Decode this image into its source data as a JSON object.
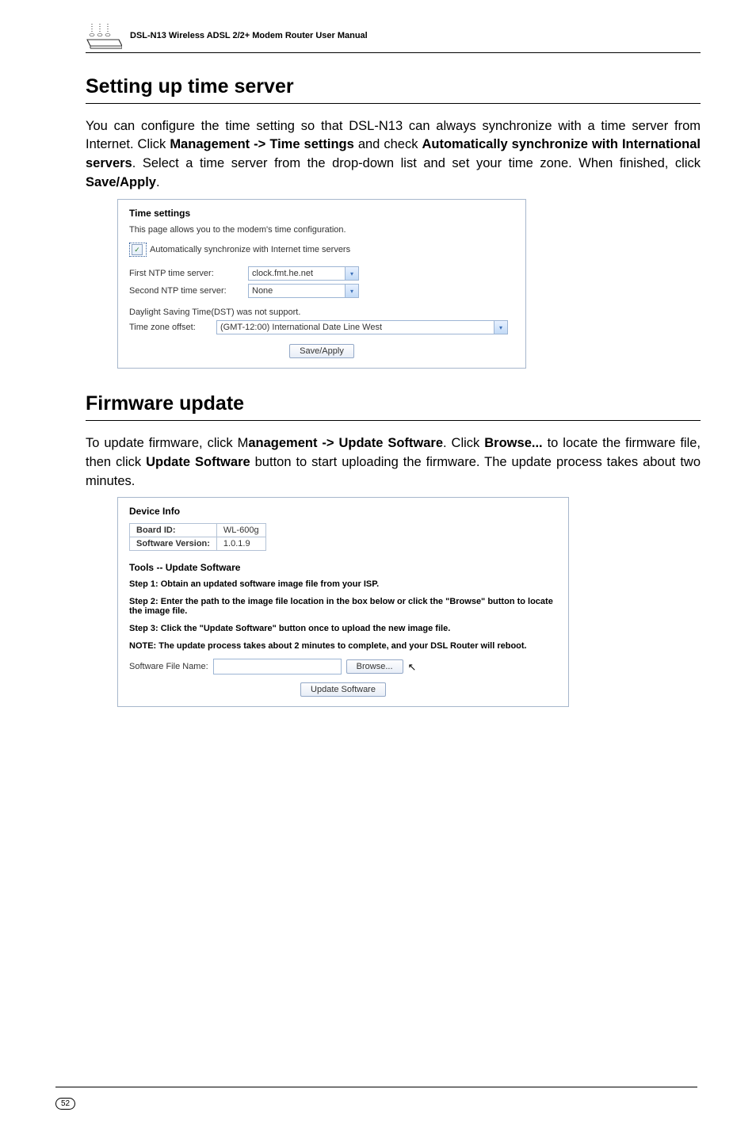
{
  "header": {
    "manual_title": "DSL-N13 Wireless ADSL 2/2+ Modem Router User Manual"
  },
  "section1": {
    "title": "Setting up time server",
    "body_parts": [
      "You can configure the time setting so that DSL-N13 can always synchronize with a time server from Internet. Click ",
      "Management -> Time settings",
      " and check ",
      "Automatically synchronize with International servers",
      ". Select a time server from the drop-down list and set your time zone. When finished, click ",
      "Save/Apply",
      "."
    ]
  },
  "screenshot1": {
    "title": "Time settings",
    "desc": "This page allows you to the modem's time configuration.",
    "checkbox_label": "Automatically synchronize with Internet time servers",
    "row1_label": "First NTP time server:",
    "row1_value": "clock.fmt.he.net",
    "row2_label": "Second NTP time server:",
    "row2_value": "None",
    "dst_label": "Daylight Saving Time(DST) was not support.",
    "tz_label": "Time zone offset:",
    "tz_value": "(GMT-12:00) International Date Line West",
    "button": "Save/Apply"
  },
  "section2": {
    "title": "Firmware update",
    "body_parts": [
      "To update firmware, click M",
      "anagement -> Update Software",
      ". Click ",
      "Browse...",
      " to locate the firmware file, then click ",
      "Update Software",
      " button to start uploading the firmware. The update process takes about two minutes."
    ]
  },
  "screenshot2": {
    "device_title": "Device Info",
    "board_id_label": "Board ID:",
    "board_id_value": "WL-600g",
    "sw_label": "Software Version:",
    "sw_value": "1.0.1.9",
    "tools_title": "Tools -- Update Software",
    "step1": "Step 1: Obtain an updated software image file from your ISP.",
    "step2": "Step 2: Enter the path to the image file location in the box below or click the \"Browse\" button to locate the image file.",
    "step3": "Step 3: Click the \"Update Software\" button once to upload the new image file.",
    "note": "NOTE: The update process takes about 2 minutes to complete, and your DSL Router will reboot.",
    "file_label": "Software File Name:",
    "browse_btn": "Browse...",
    "update_btn": "Update Software"
  },
  "footer": {
    "page_number": "52"
  }
}
